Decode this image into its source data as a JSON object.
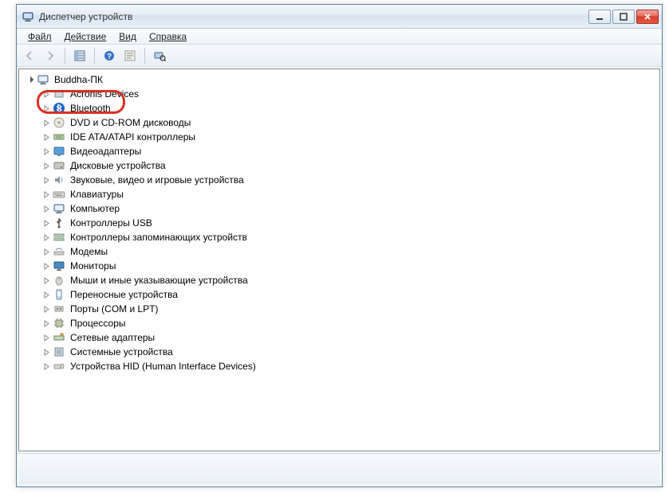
{
  "window": {
    "title": "Диспетчер устройств"
  },
  "menu": {
    "file": "Файл",
    "action": "Действие",
    "view": "Вид",
    "help": "Справка"
  },
  "tree": {
    "root": "Buddha-ПК",
    "items": [
      "Acronis Devices",
      "Bluetooth",
      "DVD и CD-ROM дисководы",
      "IDE ATA/ATAPI контроллеры",
      "Видеоадаптеры",
      "Дисковые устройства",
      "Звуковые, видео и игровые устройства",
      "Клавиатуры",
      "Компьютер",
      "Контроллеры USB",
      "Контроллеры запоминающих устройств",
      "Модемы",
      "Мониторы",
      "Мыши и иные указывающие устройства",
      "Переносные устройства",
      "Порты (COM и LPT)",
      "Процессоры",
      "Сетевые адаптеры",
      "Системные устройства",
      "Устройства HID (Human Interface Devices)"
    ],
    "highlighted_index": 1
  },
  "icons": {
    "computer": "computer-icon",
    "device_categories": [
      "generic-device-icon",
      "bluetooth-icon",
      "disc-drive-icon",
      "ide-controller-icon",
      "display-adapter-icon",
      "disk-drive-icon",
      "sound-icon",
      "keyboard-icon",
      "computer-icon",
      "usb-icon",
      "storage-controller-icon",
      "modem-icon",
      "monitor-icon",
      "mouse-icon",
      "portable-device-icon",
      "port-icon",
      "processor-icon",
      "network-adapter-icon",
      "system-device-icon",
      "hid-icon"
    ]
  },
  "colors": {
    "highlight_ring": "#d93025",
    "window_border": "#5a7fa0"
  }
}
